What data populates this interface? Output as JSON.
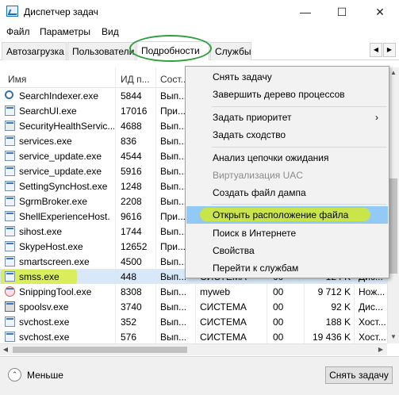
{
  "window": {
    "title": "Диспетчер задач",
    "minimize_glyph": "—",
    "maximize_glyph": "☐",
    "close_glyph": "✕"
  },
  "menu": {
    "file": "Файл",
    "params": "Параметры",
    "view": "Вид"
  },
  "tabs": [
    "Автозагрузка",
    "Пользователи",
    "Подробности",
    "Службы"
  ],
  "tab_scroll": {
    "left": "◀",
    "right": "▶"
  },
  "columns": {
    "name": "Имя",
    "pid": "ИД п...",
    "status": "Сост..."
  },
  "rows": [
    {
      "name": "SearchIndexer.exe",
      "pid": "5844",
      "status": "Вып...",
      "icon": "search-indexer-icon"
    },
    {
      "name": "SearchUI.exe",
      "pid": "17016",
      "status": "При...",
      "icon": "search-ui-icon"
    },
    {
      "name": "SecurityHealthServic...",
      "pid": "4688",
      "status": "Вып...",
      "icon": "security-health-icon"
    },
    {
      "name": "services.exe",
      "pid": "836",
      "status": "Вып...",
      "icon": "services-icon"
    },
    {
      "name": "service_update.exe",
      "pid": "4544",
      "status": "Вып...",
      "icon": "service-update-icon"
    },
    {
      "name": "service_update.exe",
      "pid": "5916",
      "status": "Вып...",
      "icon": "service-update-icon"
    },
    {
      "name": "SettingSyncHost.exe",
      "pid": "1248",
      "status": "Вып...",
      "icon": "setting-sync-icon"
    },
    {
      "name": "SgrmBroker.exe",
      "pid": "2208",
      "status": "Вып...",
      "icon": "sgrm-broker-icon"
    },
    {
      "name": "ShellExperienceHost.",
      "pid": "9616",
      "status": "При...",
      "icon": "shell-experience-icon"
    },
    {
      "name": "sihost.exe",
      "pid": "1744",
      "status": "Вып...",
      "icon": "sihost-icon"
    },
    {
      "name": "SkypeHost.exe",
      "pid": "12652",
      "status": "При...",
      "icon": "skype-host-icon"
    },
    {
      "name": "smartscreen.exe",
      "pid": "4500",
      "status": "Вып...",
      "icon": "smartscreen-icon"
    },
    {
      "name": "smss.exe",
      "pid": "448",
      "status": "Вып...",
      "user": "СИСТЕМА",
      "cpu": "00",
      "mem": "124 K",
      "desc": "Дис...",
      "icon": "smss-icon",
      "selected": true
    },
    {
      "name": "SnippingTool.exe",
      "pid": "8308",
      "status": "Вып...",
      "user": "myweb",
      "cpu": "00",
      "mem": "9 712 K",
      "desc": "Нож...",
      "icon": "snipping-tool-icon"
    },
    {
      "name": "spoolsv.exe",
      "pid": "3740",
      "status": "Вып...",
      "user": "СИСТЕМА",
      "cpu": "00",
      "mem": "92 K",
      "desc": "Диc...",
      "icon": "spoolsv-icon"
    },
    {
      "name": "svchost.exe",
      "pid": "352",
      "status": "Вып...",
      "user": "СИСТЕМА",
      "cpu": "00",
      "mem": "188 K",
      "desc": "Хост...",
      "icon": "svchost-icon"
    },
    {
      "name": "svchost.exe",
      "pid": "576",
      "status": "Вып...",
      "user": "СИСТЕМА",
      "cpu": "00",
      "mem": "19 436 K",
      "desc": "Хост...",
      "icon": "svchost-icon"
    }
  ],
  "context_menu": {
    "end_task": "Снять задачу",
    "end_tree": "Завершить дерево процессов",
    "set_priority": "Задать приоритет",
    "set_affinity": "Задать сходство",
    "analyze_wait": "Анализ цепочки ожидания",
    "uac_virt": "Виртуализация UAC",
    "create_dump": "Создать файл дампа",
    "open_location": "Открыть расположение файла",
    "search_online": "Поиск в Интернете",
    "properties": "Свойства",
    "go_services": "Перейти к службам",
    "submenu_arrow": "›"
  },
  "footer": {
    "less": "Меньше",
    "less_glyph": "⌃",
    "end_task": "Снять задачу"
  },
  "colors": {
    "highlight_green": "#d9ee3e",
    "ellipse_green": "#2e9e3c",
    "selected_row": "#d8e8f8",
    "menu_hover": "#91c9f7"
  }
}
